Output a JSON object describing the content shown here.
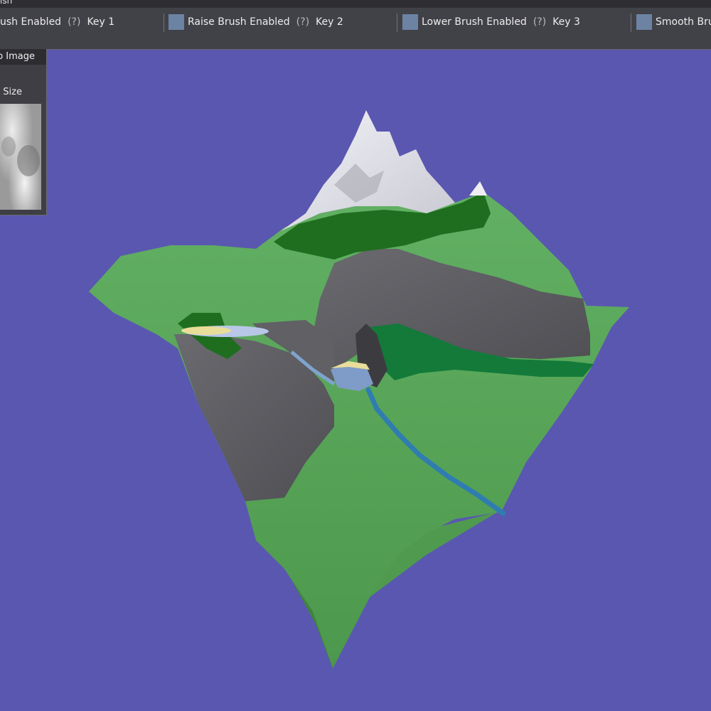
{
  "colors": {
    "sky": "#5a57b0",
    "toolbar": "#414148",
    "swatch": "#6c83a4",
    "grass": "#5aa55a",
    "forest": "#1f6f1f",
    "rock": "#5b5b60",
    "snow": "#e6e6ee",
    "water": "#3f88b0",
    "sand": "#e9dd9a"
  },
  "window": {
    "title_fragment": "ısh"
  },
  "toolbar": {
    "items": [
      {
        "label": "ush Enabled",
        "help": "(?)",
        "key": "Key 1"
      },
      {
        "label": "Raise Brush Enabled",
        "help": "(?)",
        "key": "Key 2"
      },
      {
        "label": "Lower Brush Enabled",
        "help": "(?)",
        "key": "Key 3"
      },
      {
        "label": "Smooth Brus"
      }
    ]
  },
  "panel": {
    "title": "o Image",
    "size_label": "e Size",
    "heightmap_icon": "heightmap-preview"
  }
}
